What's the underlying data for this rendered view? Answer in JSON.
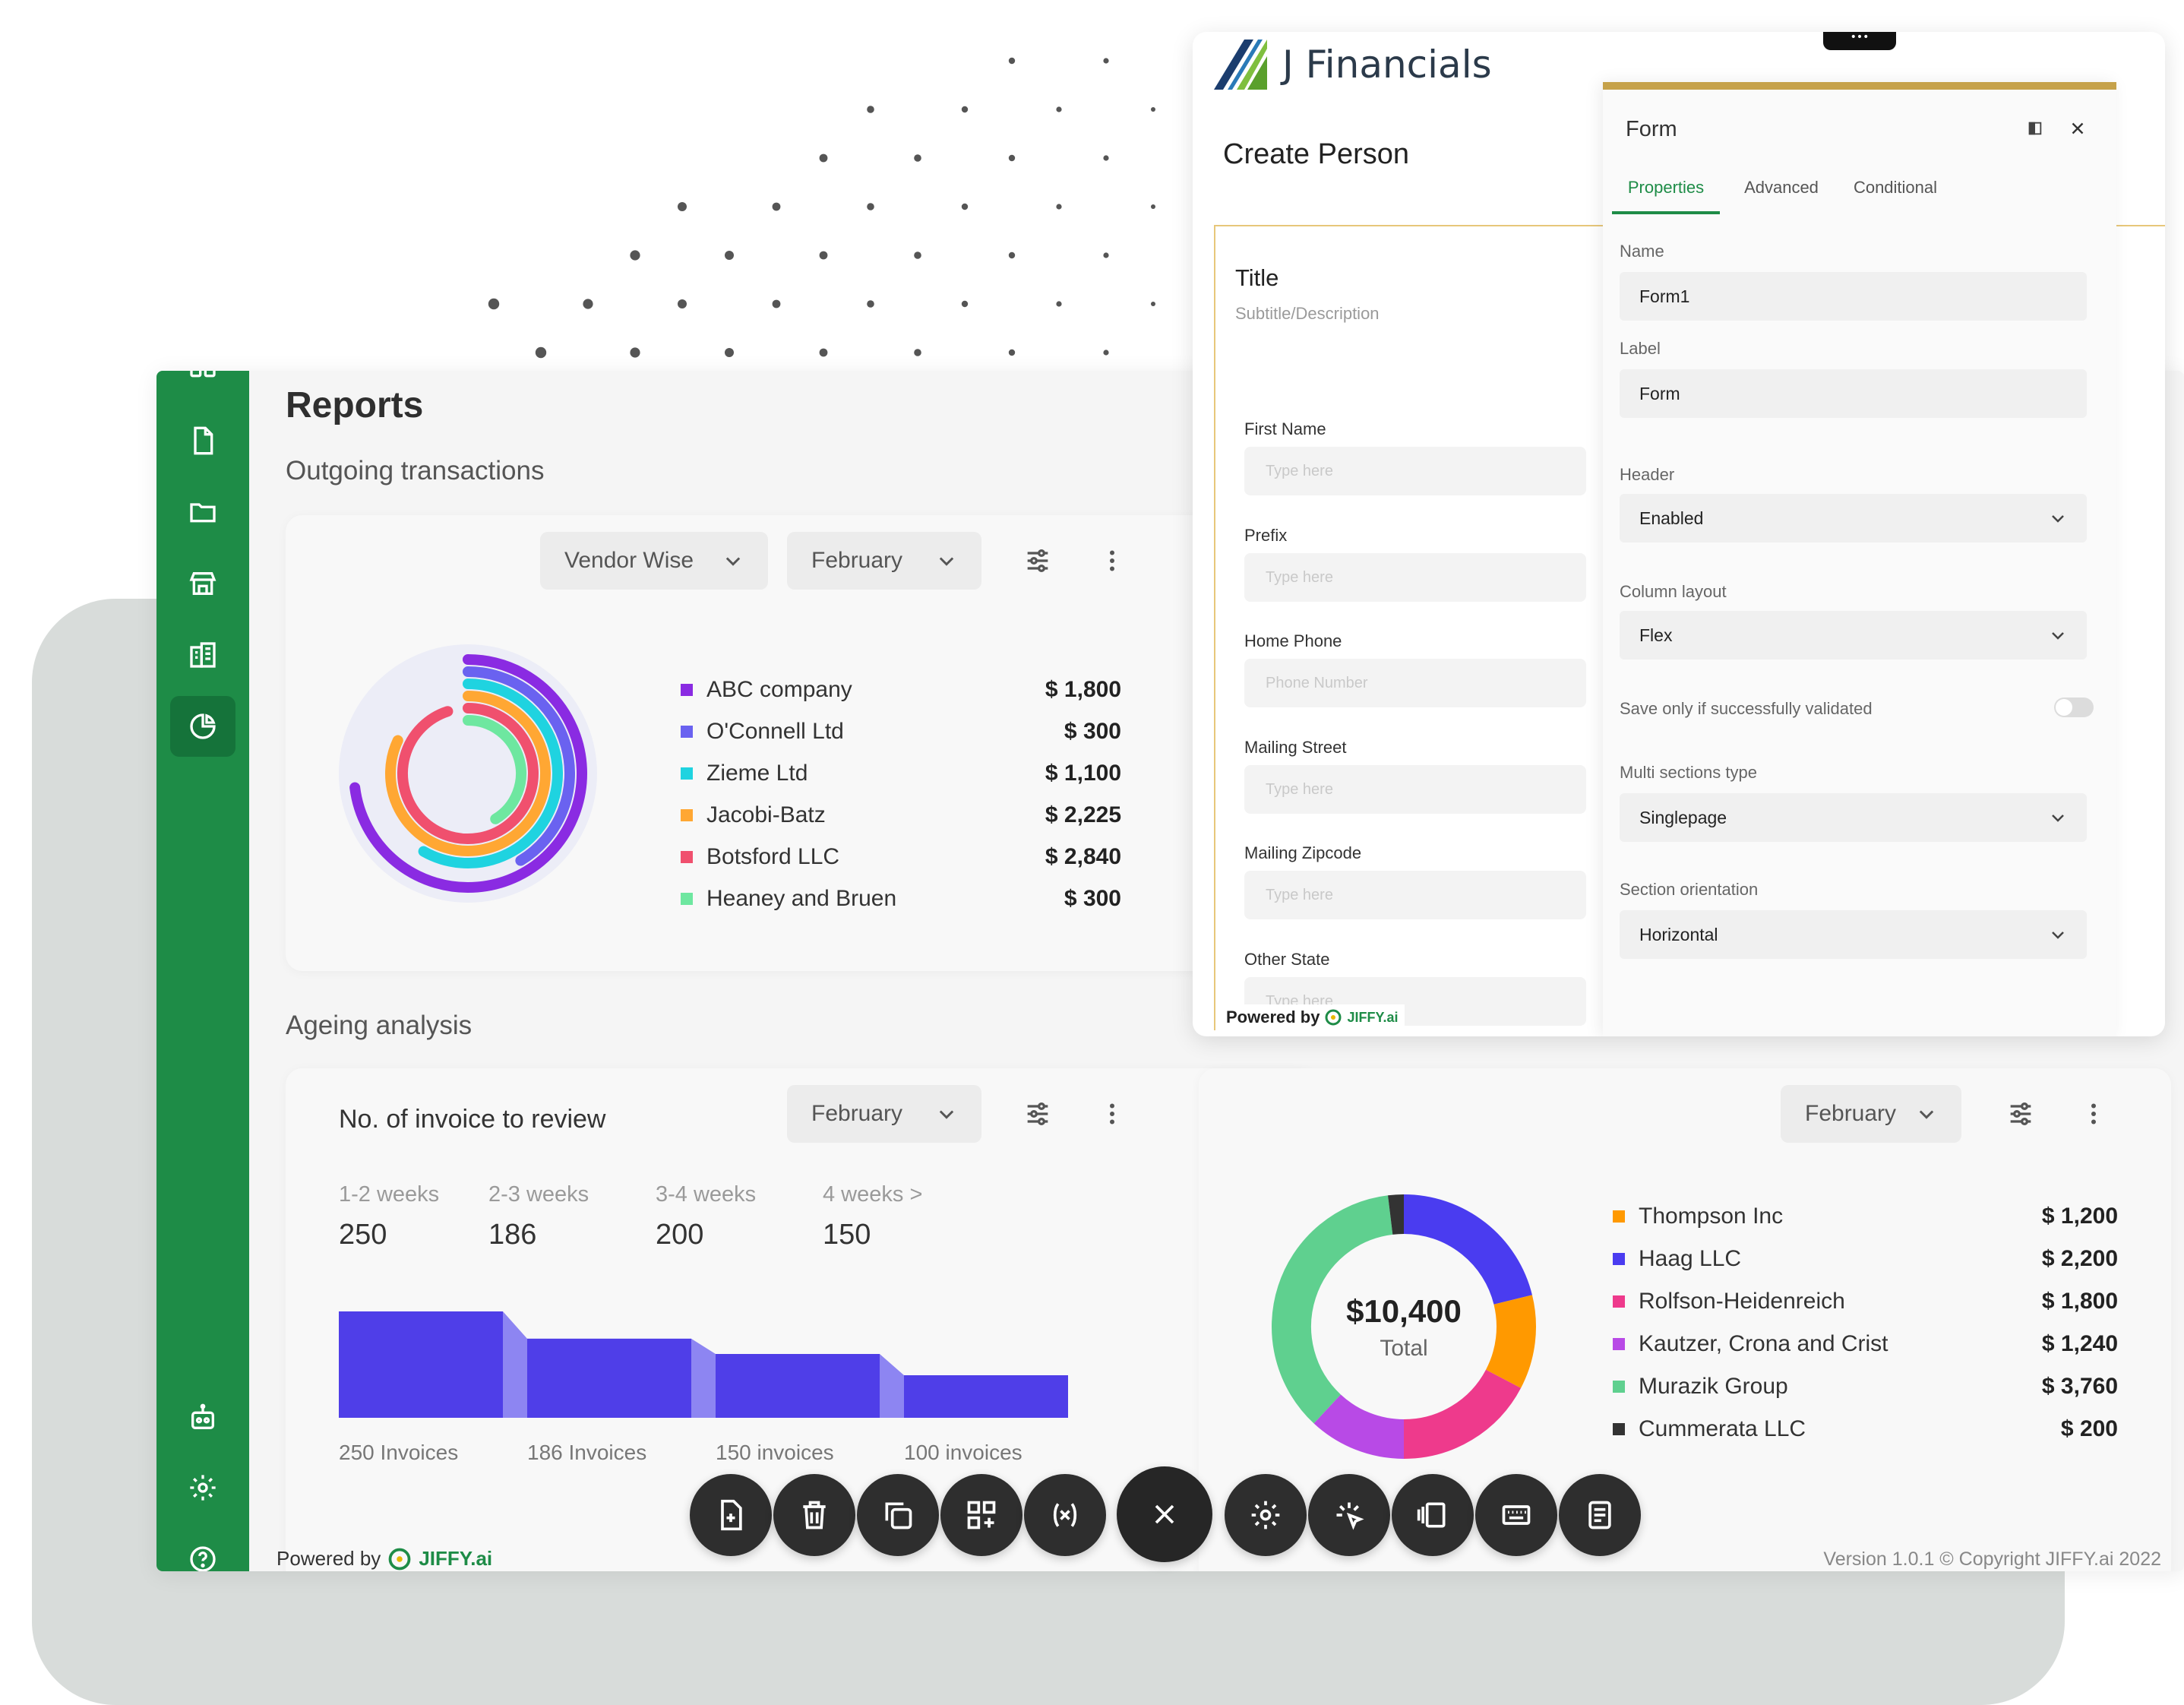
{
  "colors": {
    "sidebar": "#1e8c47",
    "brand_gold": "#c6a24a",
    "accent_green": "#1e8c47",
    "bar": "#4f3ee8"
  },
  "sidebar": {
    "items": [
      {
        "icon": "grid-icon"
      },
      {
        "icon": "document-icon"
      },
      {
        "icon": "folder-icon"
      },
      {
        "icon": "store-icon"
      },
      {
        "icon": "building-icon"
      },
      {
        "icon": "pie-chart-icon",
        "active": true
      },
      {
        "icon": "robot-icon"
      },
      {
        "icon": "gear-icon"
      },
      {
        "icon": "help-icon"
      }
    ]
  },
  "reports": {
    "title": "Reports",
    "outgoing": {
      "title": "Outgoing transactions",
      "dropdown1": "Vendor Wise",
      "dropdown2": "February",
      "legend": [
        {
          "name": "ABC company",
          "amount": "$ 1,800",
          "color": "#8a2be2"
        },
        {
          "name": "O'Connell Ltd",
          "amount": "$ 300",
          "color": "#6a62f0"
        },
        {
          "name": "Zieme Ltd",
          "amount": "$ 1,100",
          "color": "#1fd3e0"
        },
        {
          "name": "Jacobi-Batz",
          "amount": "$ 2,225",
          "color": "#ffa733"
        },
        {
          "name": "Botsford LLC",
          "amount": "$ 2,840",
          "color": "#f0506e"
        },
        {
          "name": "Heaney and Bruen",
          "amount": "$ 300",
          "color": "#6ee7a0"
        }
      ]
    },
    "ageing": {
      "title": "Ageing analysis",
      "card_title": "No. of invoice to review",
      "dropdown": "February",
      "weeks": [
        {
          "label": "1-2 weeks",
          "value": "250"
        },
        {
          "label": "2-3 weeks",
          "value": "186"
        },
        {
          "label": "3-4 weeks",
          "value": "200"
        },
        {
          "label": "4 weeks >",
          "value": "150"
        }
      ],
      "bars": [
        {
          "label": "250 Invoices",
          "value": 250
        },
        {
          "label": "186 Invoices",
          "value": 186
        },
        {
          "label": "150 invoices",
          "value": 150
        },
        {
          "label": "100 invoices",
          "value": 100
        }
      ]
    },
    "donut": {
      "dropdown": "February",
      "total": "$10,400",
      "total_label": "Total",
      "legend": [
        {
          "name": "Thompson Inc",
          "amount": "$ 1,200",
          "color": "#ff9900"
        },
        {
          "name": "Haag LLC",
          "amount": "$ 2,200",
          "color": "#4a3cf0"
        },
        {
          "name": "Rolfson-Heidenreich",
          "amount": "$ 1,800",
          "color": "#ee3a8c"
        },
        {
          "name": "Kautzer, Crona and Crist",
          "amount": "$ 1,240",
          "color": "#b84ae6"
        },
        {
          "name": "Murazik Group",
          "amount": "$ 3,760",
          "color": "#5fd08f"
        },
        {
          "name": "Cummerata LLC",
          "amount": "$ 200",
          "color": "#333333"
        }
      ]
    },
    "footer": {
      "powered": "Powered by",
      "brand": "JIFFY.ai",
      "version": "Version 1.0.1  © Copyright JIFFY.ai 2022"
    }
  },
  "toolbar": [
    {
      "icon": "add-file-icon"
    },
    {
      "icon": "trash-icon"
    },
    {
      "icon": "copy-icon"
    },
    {
      "icon": "add-widget-icon"
    },
    {
      "icon": "variable-icon"
    },
    {
      "icon": "close-icon"
    },
    {
      "icon": "settings-icon"
    },
    {
      "icon": "magic-click-icon"
    },
    {
      "icon": "layout-icon"
    },
    {
      "icon": "keyboard-icon"
    },
    {
      "icon": "notes-icon"
    }
  ],
  "form_window": {
    "brand": "J Financials",
    "heading": "Create Person",
    "form_title": "Title",
    "form_subtitle": "Subtitle/Description",
    "fields": [
      {
        "label": "First Name",
        "placeholder": "Type here"
      },
      {
        "label": "Prefix",
        "placeholder": "Type here"
      },
      {
        "label": "Home Phone",
        "placeholder": "Phone Number"
      },
      {
        "label": "Mailing Street",
        "placeholder": "Type here"
      },
      {
        "label": "Mailing Zipcode",
        "placeholder": "Type here"
      },
      {
        "label": "Other State",
        "placeholder": "Type here"
      }
    ],
    "powered": "Powered by",
    "brand_small": "JIFFY.ai"
  },
  "properties": {
    "title": "Form",
    "tabs": [
      "Properties",
      "Advanced",
      "Conditional"
    ],
    "name_label": "Name",
    "name_value": "Form1",
    "label_label": "Label",
    "label_value": "Form",
    "header_label": "Header",
    "header_value": "Enabled",
    "column_label": "Column layout",
    "column_value": "Flex",
    "validate_label": "Save only if successfully validated",
    "multi_label": "Multi sections type",
    "multi_value": "Singlepage",
    "orient_label": "Section orientation",
    "orient_value": "Horizontal"
  }
}
